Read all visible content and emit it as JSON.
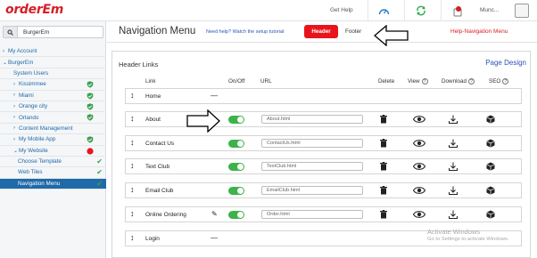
{
  "app": {
    "logo": "orderEm",
    "top_help": "Get Help",
    "user": "Munc..."
  },
  "sidebar": {
    "search_value": "BurgerEm",
    "items": [
      {
        "label": "My Account",
        "level": 0,
        "chevron": "right"
      },
      {
        "label": "BurgerEm",
        "level": 0,
        "chevron": "down"
      },
      {
        "label": "System Users",
        "level": 1
      },
      {
        "label": "Kissimmee",
        "level": 1,
        "chevron": "right",
        "badge": "shield-green"
      },
      {
        "label": "Miami",
        "level": 1,
        "chevron": "right",
        "badge": "shield-green"
      },
      {
        "label": "Orange city",
        "level": 1,
        "chevron": "right",
        "badge": "shield-green"
      },
      {
        "label": "Orlando",
        "level": 1,
        "chevron": "right",
        "badge": "shield-green"
      },
      {
        "label": "Content Management",
        "level": 1,
        "chevron": "right"
      },
      {
        "label": "My Mobile App",
        "level": 1,
        "chevron": "right",
        "badge": "shield-green"
      },
      {
        "label": "My Website",
        "level": 1,
        "chevron": "down",
        "badge": "red-dot"
      },
      {
        "label": "Choose Template",
        "level": 2,
        "check": true
      },
      {
        "label": "Web Tiles",
        "level": 2,
        "check": true
      },
      {
        "label": "Navigation Menu",
        "level": 2,
        "active": true,
        "check": true
      }
    ]
  },
  "header": {
    "title": "Navigation Menu",
    "help_link": "Need help? Watch the setup tutorial",
    "tab_header": "Header",
    "tab_footer": "Footer",
    "help_nav": "Help-Navigation Menu"
  },
  "panel": {
    "title": "Header Links",
    "page_design": "Page Design",
    "columns": {
      "link": "Link",
      "onoff": "On/Off",
      "url": "URL",
      "delete": "Delete",
      "view": "View",
      "download": "Download",
      "seo": "SEO"
    },
    "rows": [
      {
        "label": "Home",
        "url": "",
        "toggle": false,
        "pen": false
      },
      {
        "label": "About",
        "url": "About.html",
        "toggle": true,
        "pen": false
      },
      {
        "label": "Contact Us",
        "url": "ContactUs.html",
        "toggle": true,
        "pen": false
      },
      {
        "label": "Text Club",
        "url": "TextClub.html",
        "toggle": true,
        "pen": false
      },
      {
        "label": "Email Club",
        "url": "EmailClub.html",
        "toggle": true,
        "pen": false
      },
      {
        "label": "Online Ordering",
        "url": "Order.html",
        "toggle": true,
        "pen": true
      },
      {
        "label": "Login",
        "url": "",
        "toggle": false,
        "pen": false
      }
    ]
  },
  "watermark": {
    "title": "Activate Windows",
    "subtitle": "Go to Settings to activate Windows."
  },
  "colors": {
    "brand_red": "#d61f26",
    "link_blue": "#2a53b8",
    "toggle_green": "#3bb34a",
    "active_nav": "#1f6aa8"
  }
}
